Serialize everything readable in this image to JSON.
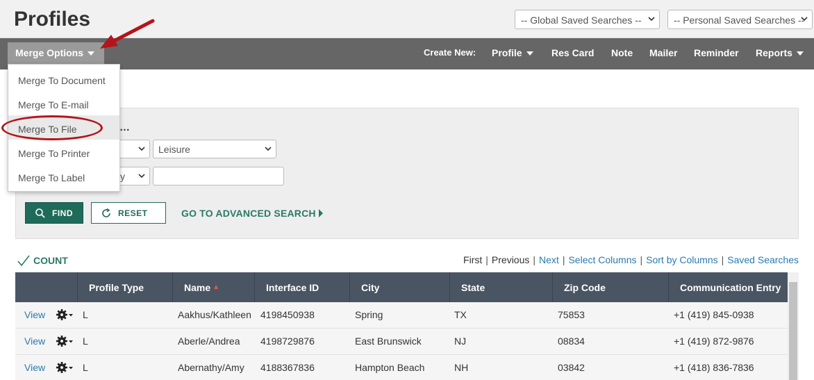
{
  "header": {
    "title": "Profiles",
    "global_searches": "-- Global Saved Searches --",
    "personal_searches": "-- Personal Saved Searches --"
  },
  "navbar": {
    "merge_options": "Merge Options",
    "create_new_label": "Create New:",
    "profile": "Profile",
    "res_card": "Res Card",
    "note": "Note",
    "mailer": "Mailer",
    "reminder": "Reminder",
    "reports": "Reports"
  },
  "merge_menu": {
    "items": [
      {
        "label": "Merge To Document"
      },
      {
        "label": "Merge To E-mail"
      },
      {
        "label": "Merge To File"
      },
      {
        "label": "Merge To Printer"
      },
      {
        "label": "Merge To Label"
      }
    ]
  },
  "search": {
    "partial_text": "…",
    "filter1_value": "",
    "filter2_value": "Leisure",
    "filter3_value": "y",
    "text_value": "",
    "find_label": "FIND",
    "reset_label": "RESET",
    "advanced_label": "GO TO ADVANCED SEARCH"
  },
  "results": {
    "count_label": "COUNT",
    "pager": {
      "first": "First",
      "previous": "Previous",
      "next": "Next",
      "select_columns": "Select Columns",
      "sort_by_columns": "Sort by Columns",
      "saved_searches": "Saved Searches"
    },
    "columns": [
      "Profile Type",
      "Name",
      "Interface ID",
      "City",
      "State",
      "Zip Code",
      "Communication Entry"
    ],
    "rows": [
      {
        "action": "View",
        "type": "L",
        "name": "Aakhus/Kathleen",
        "interface_id": "4198450938",
        "city": "Spring",
        "state": "TX",
        "zip": "75853",
        "comm": "+1 (419) 845-0938"
      },
      {
        "action": "View",
        "type": "L",
        "name": "Aberle/Andrea",
        "interface_id": "4198729876",
        "city": "East Brunswick",
        "state": "NJ",
        "zip": "08834",
        "comm": "+1 (419) 872-9876"
      },
      {
        "action": "View",
        "type": "L",
        "name": "Abernathy/Amy",
        "interface_id": "4188367836",
        "city": "Hampton Beach",
        "state": "NH",
        "zip": "03842",
        "comm": "+1 (418) 836-7836"
      }
    ]
  },
  "colors": {
    "navbar": "#666666",
    "accent_green": "#1f6b5a",
    "link_blue": "#2a7ab0",
    "annotation_red": "#b3151b",
    "table_header": "#4a5563"
  }
}
